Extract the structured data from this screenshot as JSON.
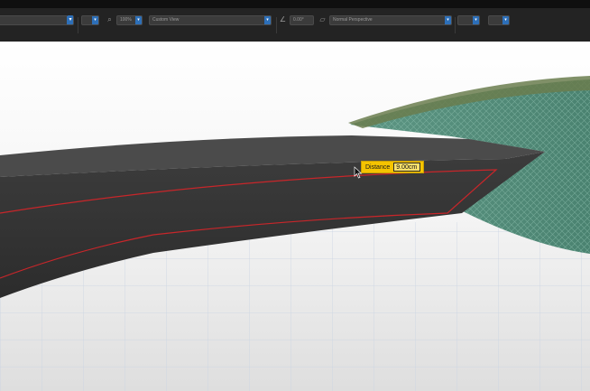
{
  "toolbar": {
    "zoom_value": "100%",
    "view_dropdown": "Custom View",
    "angle_value": "0.00°",
    "projection_dropdown": "Normal Perspective"
  },
  "icons": {
    "grid": "grid-icon",
    "zoom": "magnifier-icon",
    "angle": "angle-icon",
    "projection": "perspective-icon"
  },
  "measure": {
    "label": "Distance",
    "value": "9.00cm"
  },
  "colors": {
    "toolbar": "#232323",
    "hud_bg": "#f5c400",
    "outline": "#c8262a",
    "wall": "#4f8a78"
  }
}
